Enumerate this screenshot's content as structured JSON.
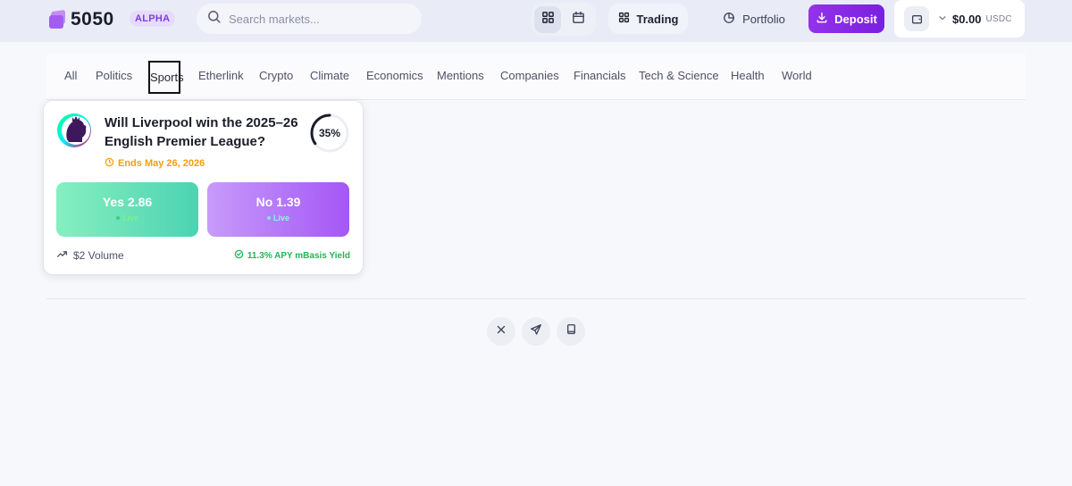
{
  "header": {
    "logo_text": "5050",
    "badge": "ALPHA",
    "search_placeholder": "Search markets...",
    "trading_label": "Trading",
    "portfolio_label": "Portfolio",
    "deposit_label": "Deposit",
    "wallet_amount": "$0.00",
    "wallet_unit": "USDC"
  },
  "categories": [
    "All",
    "Politics",
    "Sports",
    "Etherlink",
    "Crypto",
    "Climate",
    "Economics",
    "Mentions",
    "Companies",
    "Financials",
    "Tech & Science",
    "Health",
    "World"
  ],
  "selected_category": "Sports",
  "market": {
    "title": "Will Liverpool win the 2025–26 English Premier League?",
    "ends": "Ends May 26, 2026",
    "probability_label": "35%",
    "probability": 0.35,
    "yes_label": "Yes 2.86",
    "no_label": "No 1.39",
    "live_label": "Live",
    "volume": "$2 Volume",
    "yield": "11.3% APY mBasis Yield"
  },
  "colors": {
    "accent": "#9333ea",
    "yes_gradient": [
      "#86efc0",
      "#4cd3b2"
    ],
    "no_gradient": [
      "#c79bfb",
      "#a457f5"
    ],
    "warning": "#f59e0b",
    "success": "#22b455"
  },
  "footer": {
    "icons": [
      "x-icon",
      "send-icon",
      "book-icon"
    ]
  }
}
